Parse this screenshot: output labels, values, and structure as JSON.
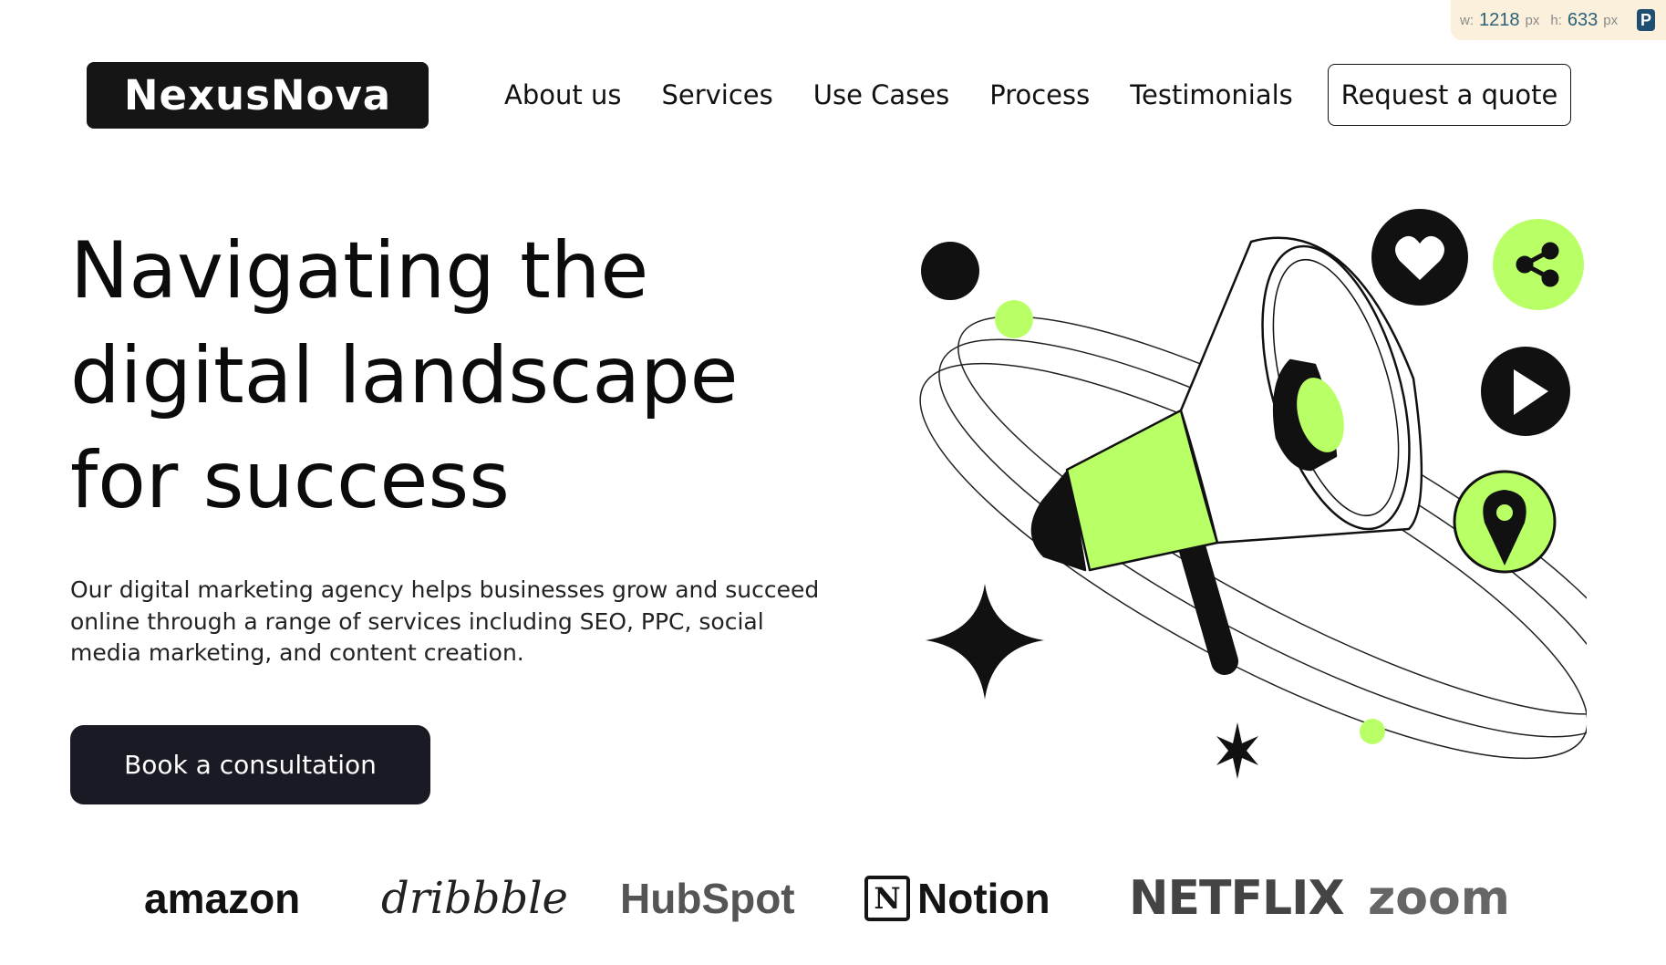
{
  "ruler": {
    "w_label": "w:",
    "w_value": "1218",
    "w_unit": "px",
    "h_label": "h:",
    "h_value": "633",
    "h_unit": "px",
    "icon": "P"
  },
  "header": {
    "logo": "NexusNova",
    "nav": [
      "About us",
      "Services",
      "Use Cases",
      "Process",
      "Testimonials"
    ],
    "quote_button": "Request a quote"
  },
  "hero": {
    "title": "Navigating the\ndigital landscape\nfor success",
    "description": "Our digital marketing agency helps businesses grow and succeed online through a range of services including SEO, PPC, social media marketing, and content creation.",
    "cta": "Book a consultation"
  },
  "colors": {
    "accent": "#b9ff66",
    "dark": "#191a23",
    "ruler_bg": "#fbf0dc"
  },
  "illustration": {
    "icons": [
      "megaphone-icon",
      "heart-icon",
      "share-icon",
      "play-icon",
      "location-pin-icon",
      "sparkle-icon"
    ]
  },
  "brands": {
    "amazon": "amazon",
    "dribbble": "dribbble",
    "hubspot": "HubSpot",
    "notion_mark": "N",
    "notion": "Notion",
    "netflix": "NETFLIX",
    "zoom": "zoom"
  }
}
